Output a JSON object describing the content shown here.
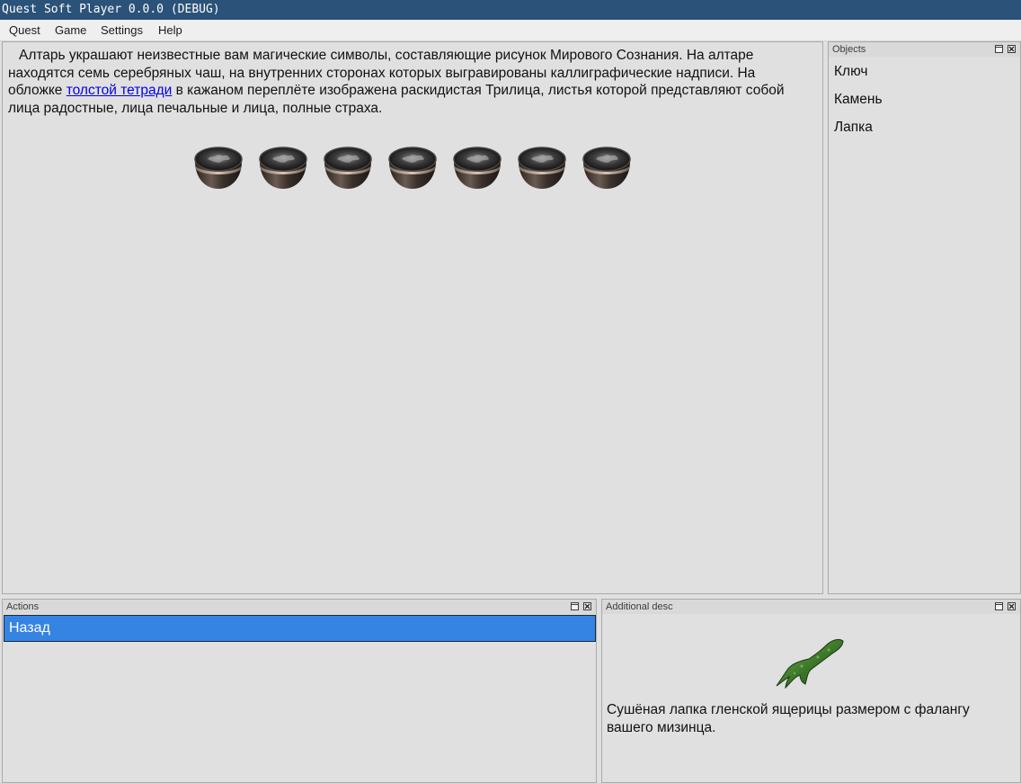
{
  "window": {
    "title": "Quest Soft Player 0.0.0 (DEBUG)"
  },
  "menu": {
    "items": [
      "Quest",
      "Game",
      "Settings",
      "Help"
    ]
  },
  "main": {
    "text_before_link": "Алтарь украшают неизвестные вам магические символы, составляющие рисунок Мирового Сознания. На алтаре находятся семь серебряных чаш, на внутренних сторонах которых выгравированы каллиграфические надписи. На обложке ",
    "link_text": "толстой тетради",
    "text_after_link": " в кажаном переплёте изображена раскидистая Трилица, листья которой представляют собой лица радостные, лица печальные и лица, полные страха."
  },
  "objects_panel": {
    "title": "Objects",
    "items": [
      "Ключ",
      "Камень",
      "Лапка"
    ]
  },
  "actions_panel": {
    "title": "Actions",
    "items": [
      "Назад"
    ]
  },
  "desc_panel": {
    "title": "Additional desc",
    "text": "Сушёная лапка гленской ящерицы размером с фалангу вашего мизинца."
  },
  "colors": {
    "titlebar": "#2b5278",
    "selection": "#3584e4",
    "link": "#0000ee",
    "background": "#e0e0e0"
  },
  "icons": [
    "bowl-image",
    "lizard-paw-image",
    "float-icon",
    "close-icon"
  ]
}
